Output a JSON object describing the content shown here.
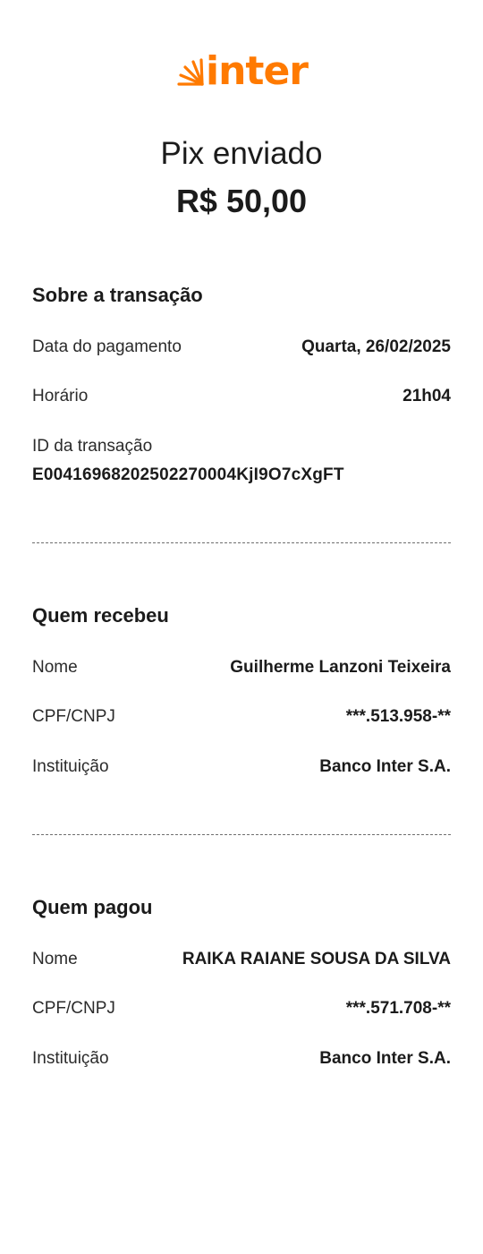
{
  "brand": {
    "name": "inter",
    "logo_icon": "inter-rays-icon",
    "color": "#ff7a00"
  },
  "header": {
    "title": "Pix enviado",
    "amount": "R$ 50,00"
  },
  "transaction": {
    "section_title": "Sobre a transação",
    "date_label": "Data do pagamento",
    "date_value": "Quarta, 26/02/2025",
    "time_label": "Horário",
    "time_value": "21h04",
    "id_label": "ID da transação",
    "id_value": "E00416968202502270004KjI9O7cXgFT"
  },
  "receiver": {
    "section_title": "Quem recebeu",
    "name_label": "Nome",
    "name_value": "Guilherme Lanzoni Teixeira",
    "doc_label": "CPF/CNPJ",
    "doc_value": "***.513.958-**",
    "institution_label": "Instituição",
    "institution_value": "Banco Inter S.A."
  },
  "payer": {
    "section_title": "Quem pagou",
    "name_label": "Nome",
    "name_value": "RAIKA RAIANE SOUSA DA SILVA",
    "doc_label": "CPF/CNPJ",
    "doc_value": "***.571.708-**",
    "institution_label": "Instituição",
    "institution_value": "Banco Inter S.A."
  }
}
